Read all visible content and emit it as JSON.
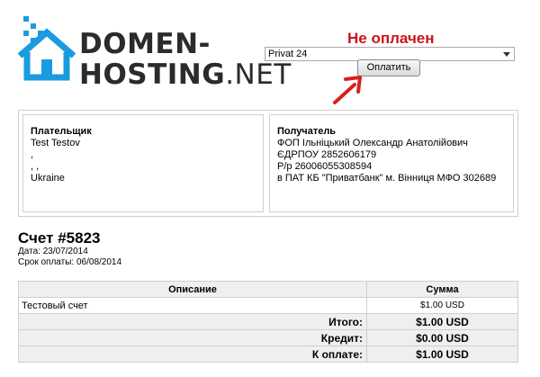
{
  "brand": {
    "line1": "DOMEN-",
    "line2_bold": "HOSTING",
    "line2_light": ".NET",
    "color": "#1a9be0"
  },
  "status": {
    "text": "Не оплачен",
    "color": "#c8141c"
  },
  "payment": {
    "selected_gateway": "Privat 24",
    "pay_button": "Оплатить"
  },
  "payer": {
    "title": "Плательщик",
    "lines": [
      "Test Testov",
      ",",
      ", ,",
      "Ukraine"
    ]
  },
  "payee": {
    "title": "Получатель",
    "lines": [
      "ФОП Ільніцький Олександр Анатолійович",
      "ЄДРПОУ 2852606179",
      "Р/р 26006055308594",
      "в ПАТ КБ \"Приватбанк\" м. Вінниця МФО 302689"
    ]
  },
  "invoice": {
    "title": "Счет #5823",
    "date": "Дата: 23/07/2014",
    "due": "Срок оплаты: 06/08/2014"
  },
  "items": {
    "headers": [
      "Описание",
      "Сумма"
    ],
    "rows": [
      {
        "description": "Тестовый счет",
        "amount": "$1.00 USD"
      }
    ],
    "totals": [
      {
        "label": "Итого:",
        "value": "$1.00 USD"
      },
      {
        "label": "Кредит:",
        "value": "$0.00 USD"
      },
      {
        "label": "К оплате:",
        "value": "$1.00 USD"
      }
    ]
  }
}
